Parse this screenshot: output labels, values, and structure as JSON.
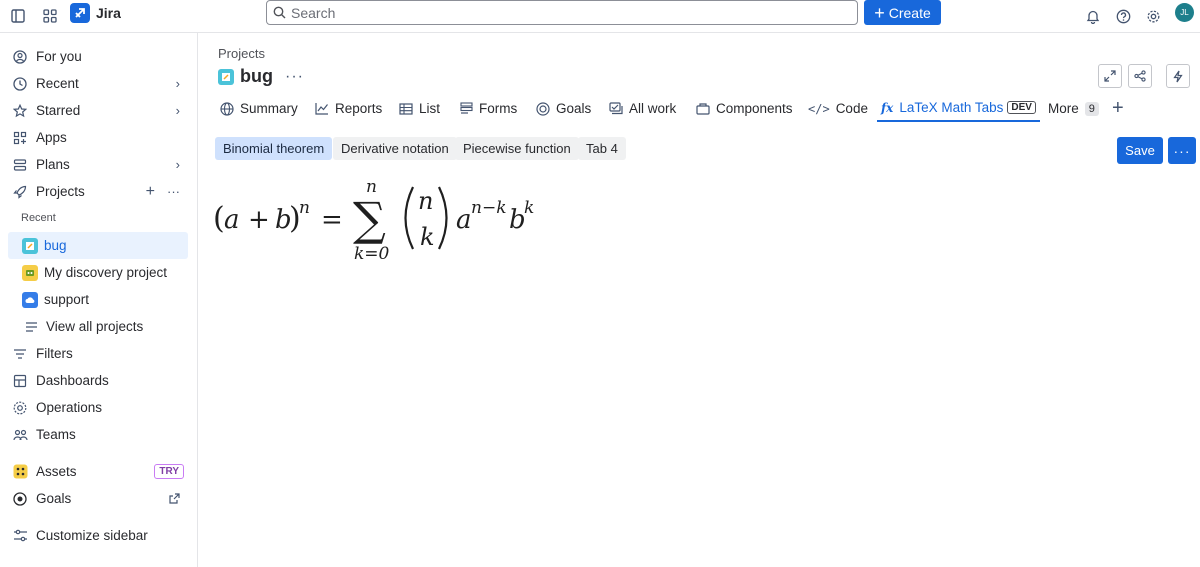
{
  "topbar": {
    "app_name": "Jira",
    "search_placeholder": "Search",
    "create_label": "Create",
    "avatar_initials": "JL"
  },
  "sidebar": {
    "items": [
      {
        "label": "For you",
        "icon": "user-circle-icon"
      },
      {
        "label": "Recent",
        "icon": "clock-icon"
      },
      {
        "label": "Starred",
        "icon": "star-icon"
      },
      {
        "label": "Apps",
        "icon": "apps-grid-icon"
      },
      {
        "label": "Plans",
        "icon": "plans-icon"
      },
      {
        "label": "Projects",
        "icon": "rocket-icon"
      }
    ],
    "recent_heading": "Recent",
    "projects": [
      {
        "label": "bug",
        "selected": true
      },
      {
        "label": "My discovery project"
      },
      {
        "label": "support"
      }
    ],
    "view_all": "View all projects",
    "lower_items": [
      {
        "label": "Filters",
        "icon": "filter-icon"
      },
      {
        "label": "Dashboards",
        "icon": "dashboard-icon"
      },
      {
        "label": "Operations",
        "icon": "operations-icon"
      },
      {
        "label": "Teams",
        "icon": "teams-icon"
      }
    ],
    "assets": "Assets",
    "assets_badge": "TRY",
    "goals": "Goals",
    "customize": "Customize sidebar"
  },
  "main": {
    "breadcrumb": "Projects",
    "project_name": "bug",
    "tabs": [
      {
        "label": "Summary",
        "icon": "globe-icon"
      },
      {
        "label": "Reports",
        "icon": "chart-line-icon"
      },
      {
        "label": "List",
        "icon": "list-icon"
      },
      {
        "label": "Forms",
        "icon": "forms-icon"
      },
      {
        "label": "Goals",
        "icon": "target-icon"
      },
      {
        "label": "All work",
        "icon": "all-work-icon"
      },
      {
        "label": "Components",
        "icon": "components-icon"
      },
      {
        "label": "Code",
        "icon": "code-icon"
      },
      {
        "label": "LaTeX Math Tabs",
        "icon": "fx-icon",
        "badge": "DEV",
        "active": true
      },
      {
        "label": "More",
        "count": "9"
      }
    ],
    "latex_tabs": [
      {
        "label": "Binomial theorem",
        "active": true
      },
      {
        "label": "Derivative notation"
      },
      {
        "label": "Piecewise function"
      },
      {
        "label": "Tab 4"
      }
    ],
    "save_label": "Save",
    "formula": {
      "lhs_open": "(",
      "lhs_a": "a",
      "lhs_plus": "+",
      "lhs_b": "b",
      "lhs_close": ")",
      "lhs_exp": "n",
      "equals": "=",
      "sum_upper": "n",
      "sum_symbol": "∑",
      "sum_lower": "k=0",
      "binom_top": "n",
      "binom_bottom": "k",
      "a": "a",
      "a_exp": "n−k",
      "b": "b",
      "b_exp": "k"
    },
    "colors": {
      "accent": "#1868db",
      "active_tab_bg": "#cfe1fd"
    }
  }
}
